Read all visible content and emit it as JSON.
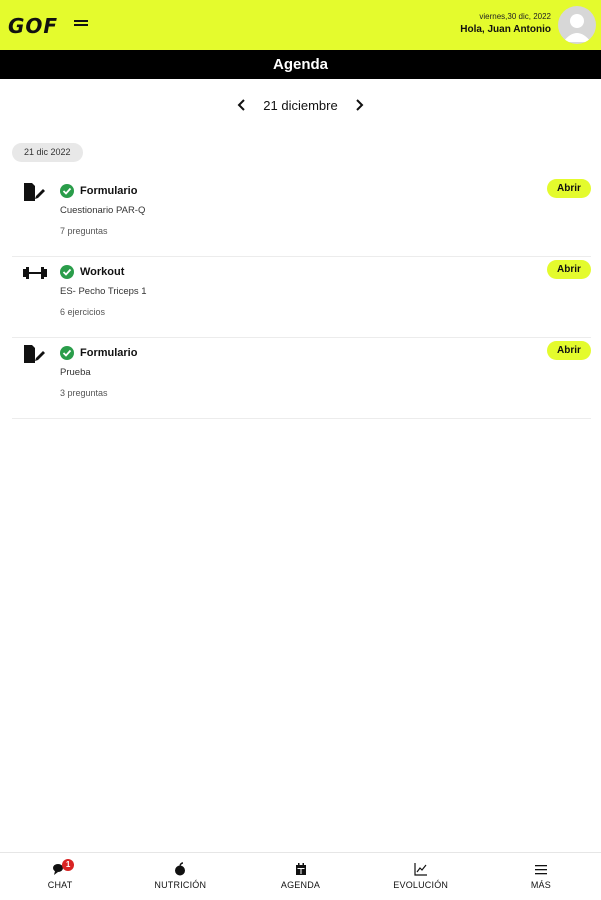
{
  "header": {
    "logo_text": "GOF",
    "date": "viernes,30 dic, 2022",
    "greeting": "Hola, Juan Antonio",
    "accent_color": "#e4fb2d"
  },
  "title": "Agenda",
  "date_nav": {
    "prev_icon": "chevron-left-icon",
    "label": "21 diciembre",
    "next_icon": "chevron-right-icon"
  },
  "day_chip": "21 dic 2022",
  "items": [
    {
      "icon": "form-icon",
      "status_icon": "check-circle-icon",
      "type": "Formulario",
      "subtitle": "Cuestionario PAR-Q",
      "count": "7 preguntas",
      "button": "Abrir"
    },
    {
      "icon": "dumbbell-icon",
      "status_icon": "check-circle-icon",
      "type": "Workout",
      "subtitle": "ES- Pecho Triceps 1",
      "count": "6 ejercicios",
      "button": "Abrir"
    },
    {
      "icon": "form-icon",
      "status_icon": "check-circle-icon",
      "type": "Formulario",
      "subtitle": "Prueba",
      "count": "3 preguntas",
      "button": "Abrir"
    }
  ],
  "bottom_nav": [
    {
      "icon": "chat-icon",
      "label": "CHAT",
      "badge": "1"
    },
    {
      "icon": "apple-icon",
      "label": "NUTRICIÓN"
    },
    {
      "icon": "calendar-icon",
      "label": "AGENDA"
    },
    {
      "icon": "chart-icon",
      "label": "EVOLUCIÓN"
    },
    {
      "icon": "menu-icon",
      "label": "MÁS"
    }
  ]
}
